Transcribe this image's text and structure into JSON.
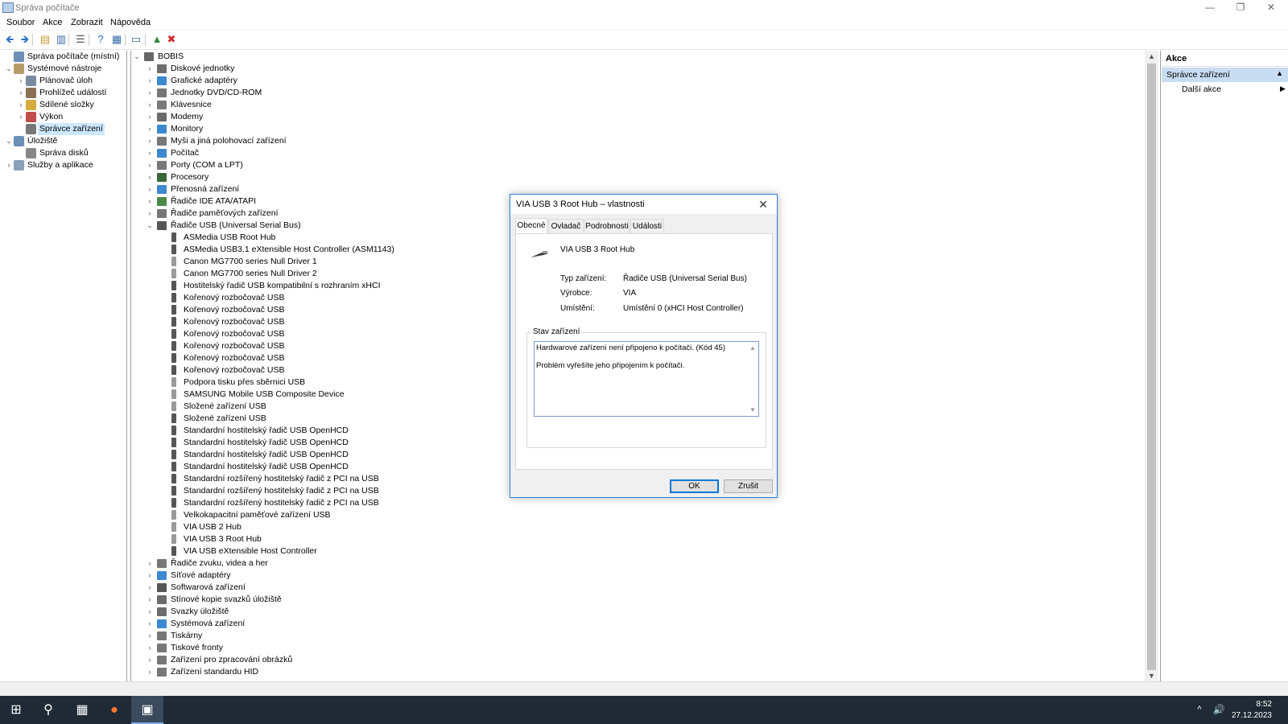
{
  "window": {
    "title": "Správa počítače",
    "minimize": "—",
    "restore": "❐",
    "close": "✕"
  },
  "menu": [
    "Soubor",
    "Akce",
    "Zobrazit",
    "Nápověda"
  ],
  "toolbar": {
    "icons": [
      {
        "name": "back-arrow-icon",
        "glyph": "🡸",
        "color": "#2a6fc9"
      },
      {
        "name": "forward-arrow-icon",
        "glyph": "🡺",
        "color": "#2a6fc9"
      },
      {
        "name": "up-folder-icon",
        "glyph": "▤",
        "color": "#c99a2e"
      },
      {
        "name": "console-tree-icon",
        "glyph": "▥",
        "color": "#3c6ea8"
      },
      {
        "name": "properties-list-icon",
        "glyph": "☰",
        "color": "#5b5b5b"
      },
      {
        "name": "help-icon",
        "glyph": "?",
        "color": "#2a6fc9"
      },
      {
        "name": "show-hide-action-pane-icon",
        "glyph": "▦",
        "color": "#3c6ea8"
      },
      {
        "name": "monitor-icon",
        "glyph": "▭",
        "color": "#3c6ea8"
      },
      {
        "name": "update-driver-icon",
        "glyph": "▲",
        "color": "#2d8a3e"
      },
      {
        "name": "uninstall-x-icon",
        "glyph": "✖",
        "color": "#d9262b"
      }
    ]
  },
  "left_tree": [
    {
      "label": "Správa počítače (místní)",
      "level": 0,
      "chev": "",
      "color": "#6b8fb8",
      "icon": "computer-management-icon"
    },
    {
      "label": "Systémové nástroje",
      "level": 0,
      "chev": "⌄",
      "color": "#b59b6a",
      "icon": "system-tools-icon"
    },
    {
      "label": "Plánovač úloh",
      "level": 1,
      "chev": "›",
      "color": "#7a8aa0",
      "icon": "task-scheduler-icon"
    },
    {
      "label": "Prohlížeč událostí",
      "level": 1,
      "chev": "›",
      "color": "#8a6f52",
      "icon": "event-viewer-icon"
    },
    {
      "label": "Sdílené složky",
      "level": 1,
      "chev": "›",
      "color": "#d5ad3f",
      "icon": "shared-folders-icon"
    },
    {
      "label": "Výkon",
      "level": 1,
      "chev": "›",
      "color": "#c24d4d",
      "icon": "performance-icon"
    },
    {
      "label": "Správce zařízení",
      "level": 1,
      "chev": "",
      "color": "#777777",
      "icon": "device-manager-icon",
      "selected": true
    },
    {
      "label": "Úložiště",
      "level": 0,
      "chev": "⌄",
      "color": "#6b8fb8",
      "icon": "storage-icon"
    },
    {
      "label": "Správa disků",
      "level": 1,
      "chev": "",
      "color": "#888888",
      "icon": "disk-management-icon"
    },
    {
      "label": "Služby a aplikace",
      "level": 0,
      "chev": "›",
      "color": "#8aa0b8",
      "icon": "services-applications-icon"
    }
  ],
  "device_tree": {
    "root": "BOBIS",
    "categories_top": [
      {
        "label": "Diskové jednotky",
        "color": "#6c6c6c",
        "icon": "disk-drive-icon"
      },
      {
        "label": "Grafické adaptéry",
        "color": "#3c89d0",
        "icon": "display-adapter-icon"
      },
      {
        "label": "Jednotky DVD/CD-ROM",
        "color": "#777777",
        "icon": "dvd-drive-icon"
      },
      {
        "label": "Klávesnice",
        "color": "#7a7a7a",
        "icon": "keyboard-icon"
      },
      {
        "label": "Modemy",
        "color": "#6a6a6a",
        "icon": "modem-icon"
      },
      {
        "label": "Monitory",
        "color": "#3c89d0",
        "icon": "monitor-device-icon"
      },
      {
        "label": "Myši a jiná polohovací zařízení",
        "color": "#777777",
        "icon": "mouse-icon"
      },
      {
        "label": "Počítač",
        "color": "#3c89d0",
        "icon": "computer-icon"
      },
      {
        "label": "Porty (COM a LPT)",
        "color": "#777777",
        "icon": "port-icon"
      },
      {
        "label": "Procesory",
        "color": "#3a6a3a",
        "icon": "processor-icon"
      },
      {
        "label": "Přenosná zařízení",
        "color": "#3c89d0",
        "icon": "portable-device-icon"
      },
      {
        "label": "Řadiče IDE ATA/ATAPI",
        "color": "#4b8a4b",
        "icon": "ide-controller-icon"
      },
      {
        "label": "Řadiče paměťových zařízení",
        "color": "#777777",
        "icon": "storage-controller-icon"
      }
    ],
    "usb_category": "Řadiče USB (Universal Serial Bus)",
    "usb_devices": [
      {
        "label": "ASMedia USB Root Hub",
        "warn": false
      },
      {
        "label": "ASMedia USB3.1 eXtensible Host Controller (ASM1143)",
        "warn": false
      },
      {
        "label": "Canon MG7700 series Null Driver 1",
        "warn": true
      },
      {
        "label": "Canon MG7700 series Null Driver 2",
        "warn": true
      },
      {
        "label": "Hostitelský řadič USB kompatibilní s rozhraním xHCI",
        "warn": false
      },
      {
        "label": "Kořenový rozbočovač USB",
        "warn": false
      },
      {
        "label": "Kořenový rozbočovač USB",
        "warn": false
      },
      {
        "label": "Kořenový rozbočovač USB",
        "warn": false
      },
      {
        "label": "Kořenový rozbočovač USB",
        "warn": false
      },
      {
        "label": "Kořenový rozbočovač USB",
        "warn": false
      },
      {
        "label": "Kořenový rozbočovač USB",
        "warn": false
      },
      {
        "label": "Kořenový rozbočovač USB",
        "warn": false
      },
      {
        "label": "Podpora tisku přes sběrnici USB",
        "warn": true
      },
      {
        "label": "SAMSUNG Mobile USB Composite Device",
        "warn": true
      },
      {
        "label": "Složené zařízení USB",
        "warn": true
      },
      {
        "label": "Složené zařízení USB",
        "warn": false
      },
      {
        "label": "Standardní hostitelský řadič  USB OpenHCD",
        "warn": false
      },
      {
        "label": "Standardní hostitelský řadič  USB OpenHCD",
        "warn": false
      },
      {
        "label": "Standardní hostitelský řadič  USB OpenHCD",
        "warn": false
      },
      {
        "label": "Standardní hostitelský řadič  USB OpenHCD",
        "warn": false
      },
      {
        "label": "Standardní rozšířený hostitelský řadič z PCI na USB",
        "warn": false
      },
      {
        "label": "Standardní rozšířený hostitelský řadič z PCI na USB",
        "warn": false
      },
      {
        "label": "Standardní rozšířený hostitelský řadič z PCI na USB",
        "warn": false
      },
      {
        "label": "Velkokapacitní paměťové zařízení USB",
        "warn": true
      },
      {
        "label": "VIA USB 2 Hub",
        "warn": true
      },
      {
        "label": "VIA USB 3 Root Hub",
        "warn": true
      },
      {
        "label": "VIA USB eXtensible Host Controller",
        "warn": false
      }
    ],
    "categories_bottom": [
      {
        "label": "Řadiče zvuku, videa a her",
        "color": "#777777",
        "icon": "sound-controller-icon"
      },
      {
        "label": "Síťové adaptéry",
        "color": "#3c89d0",
        "icon": "network-adapter-icon"
      },
      {
        "label": "Softwarová zařízení",
        "color": "#555555",
        "icon": "software-device-icon"
      },
      {
        "label": "Stínové kopie svazků úložiště",
        "color": "#6c6c6c",
        "icon": "shadow-copy-icon"
      },
      {
        "label": "Svazky úložiště",
        "color": "#6c6c6c",
        "icon": "storage-volume-icon"
      },
      {
        "label": "Systémová zařízení",
        "color": "#3c89d0",
        "icon": "system-device-icon"
      },
      {
        "label": "Tiskárny",
        "color": "#777777",
        "icon": "printer-icon"
      },
      {
        "label": "Tiskové fronty",
        "color": "#777777",
        "icon": "print-queue-icon"
      },
      {
        "label": "Zařízení pro zpracování obrázků",
        "color": "#777777",
        "icon": "imaging-device-icon"
      },
      {
        "label": "Zařízení standardu HID",
        "color": "#777777",
        "icon": "hid-device-icon"
      }
    ]
  },
  "actions_pane": {
    "header": "Akce",
    "section": "Správce zařízení",
    "more": "Další akce"
  },
  "dialog": {
    "title": "VIA USB 3 Root Hub – vlastnosti",
    "tabs": [
      "Obecné",
      "Ovladač",
      "Podrobnosti",
      "Události"
    ],
    "device_name": "VIA USB 3 Root Hub",
    "props": [
      {
        "label": "Typ zařízení:",
        "value": "Řadiče USB (Universal Serial Bus)"
      },
      {
        "label": "Výrobce:",
        "value": "VIA"
      },
      {
        "label": "Umístění:",
        "value": "Umístění 0 (xHCI Host Controller)"
      }
    ],
    "status_caption": "Stav zařízení",
    "status_line1": "Hardwarové zařízení není připojeno k počítači. (Kód 45)",
    "status_line2": "Problém vyřešíte jeho připojením k počítači.",
    "ok": "OK",
    "cancel": "Zrušit"
  },
  "taskbar": {
    "buttons": [
      {
        "name": "start-button",
        "glyph": "⊞"
      },
      {
        "name": "search-button",
        "glyph": "⚲"
      },
      {
        "name": "calculator-button",
        "glyph": "▦"
      },
      {
        "name": "firefox-button",
        "glyph": "●"
      },
      {
        "name": "computer-management-taskbar-button",
        "glyph": "▣"
      }
    ],
    "tray_chevron": "^",
    "tray_volume": "🔊",
    "time": "8:52",
    "date": "27.12.2023"
  }
}
